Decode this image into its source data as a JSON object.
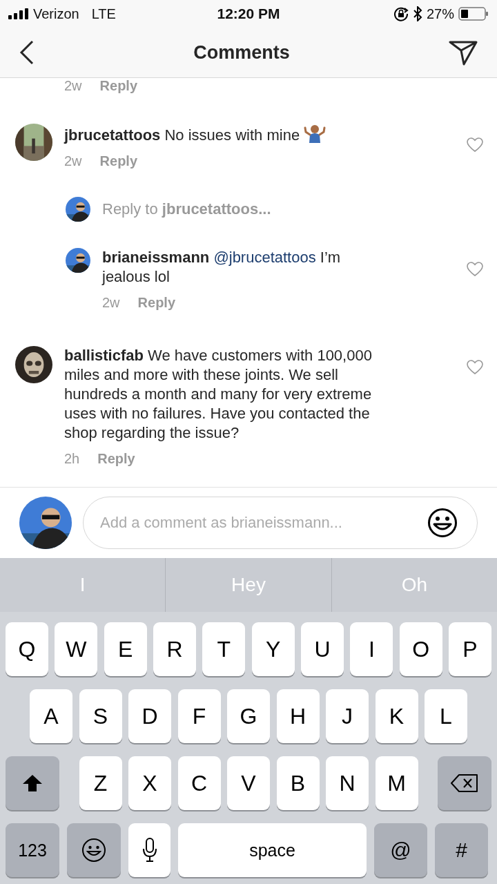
{
  "status_bar": {
    "carrier": "Verizon",
    "network": "LTE",
    "time": "12:20 PM",
    "battery": "27%"
  },
  "nav": {
    "title": "Comments"
  },
  "comments": [
    {
      "kind": "partial",
      "time": "2w",
      "reply": "Reply"
    },
    {
      "kind": "comment",
      "nested": false,
      "username": "jbrucetattoos",
      "text": "No issues with mine",
      "emoji": true,
      "liked": false,
      "time": "2w",
      "reply": "Reply"
    },
    {
      "kind": "prompt",
      "nested": true,
      "text": "Reply to **jbrucetattoos...**"
    },
    {
      "kind": "comment",
      "nested": true,
      "username": "brianeissmann",
      "mention": "@jbrucetattoos",
      "text": "I’m jealous lol",
      "liked": false,
      "time": "2w",
      "reply": "Reply"
    },
    {
      "kind": "comment",
      "nested": false,
      "username": "ballisticfab",
      "text": "We have customers with 100,000 miles and more with these joints. We sell hundreds a month and many for very extreme uses with no failures. Have you contacted the shop regarding the issue?",
      "liked": false,
      "time": "2h",
      "reply": "Reply"
    }
  ],
  "composer": {
    "placeholder": "Add a comment as brianeissmann..."
  },
  "suggestions": [
    "I",
    "Hey",
    "Oh"
  ],
  "keyboard": [
    [
      {
        "kind": "letter",
        "label": "Q"
      },
      {
        "kind": "letter",
        "label": "W"
      },
      {
        "kind": "letter",
        "label": "E"
      },
      {
        "kind": "letter",
        "label": "R"
      },
      {
        "kind": "letter",
        "label": "T"
      },
      {
        "kind": "letter",
        "label": "Y"
      },
      {
        "kind": "letter",
        "label": "U"
      },
      {
        "kind": "letter",
        "label": "I"
      },
      {
        "kind": "letter",
        "label": "O"
      },
      {
        "kind": "letter",
        "label": "P"
      }
    ],
    [
      {
        "kind": "letter",
        "label": "A"
      },
      {
        "kind": "letter",
        "label": "S"
      },
      {
        "kind": "letter",
        "label": "D"
      },
      {
        "kind": "letter",
        "label": "F"
      },
      {
        "kind": "letter",
        "label": "G"
      },
      {
        "kind": "letter",
        "label": "H"
      },
      {
        "kind": "letter",
        "label": "J"
      },
      {
        "kind": "letter",
        "label": "K"
      },
      {
        "kind": "letter",
        "label": "L"
      }
    ],
    [
      {
        "kind": "shift"
      },
      {
        "kind": "letter",
        "label": "Z"
      },
      {
        "kind": "letter",
        "label": "X"
      },
      {
        "kind": "letter",
        "label": "C"
      },
      {
        "kind": "letter",
        "label": "V"
      },
      {
        "kind": "letter",
        "label": "B"
      },
      {
        "kind": "letter",
        "label": "N"
      },
      {
        "kind": "letter",
        "label": "M"
      },
      {
        "kind": "backspace"
      }
    ],
    [
      {
        "kind": "numbers",
        "label": "123"
      },
      {
        "kind": "emoji"
      },
      {
        "kind": "mic"
      },
      {
        "kind": "space",
        "label": "space"
      },
      {
        "kind": "symbol",
        "label": "@"
      },
      {
        "kind": "symbol",
        "label": "#"
      }
    ]
  ]
}
